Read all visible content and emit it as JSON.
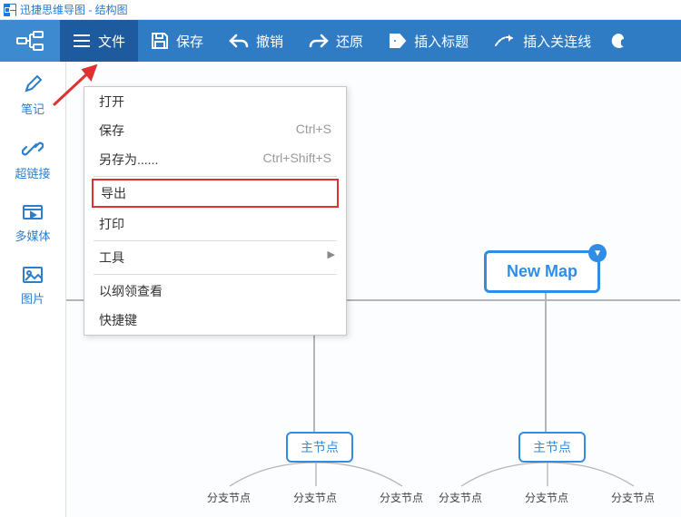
{
  "title": "迅捷思维导图 - 结构图",
  "toolbar": {
    "file_label": "文件",
    "save_label": "保存",
    "undo_label": "撤销",
    "redo_label": "还原",
    "insert_title_label": "插入标题",
    "insert_relation_label": "插入关连线"
  },
  "sidebar": {
    "note_label": "笔记",
    "link_label": "超链接",
    "media_label": "多媒体",
    "image_label": "图片"
  },
  "menu": {
    "open": "打开",
    "save": "保存",
    "save_shortcut": "Ctrl+S",
    "save_as": "另存为......",
    "save_as_shortcut": "Ctrl+Shift+S",
    "export": "导出",
    "print": "打印",
    "tools": "工具",
    "view_outline": "以纲领查看",
    "shortcuts": "快捷键"
  },
  "map": {
    "root": "New Map",
    "main1": "主节点",
    "main2": "主节点",
    "leaf": "分支节点"
  }
}
